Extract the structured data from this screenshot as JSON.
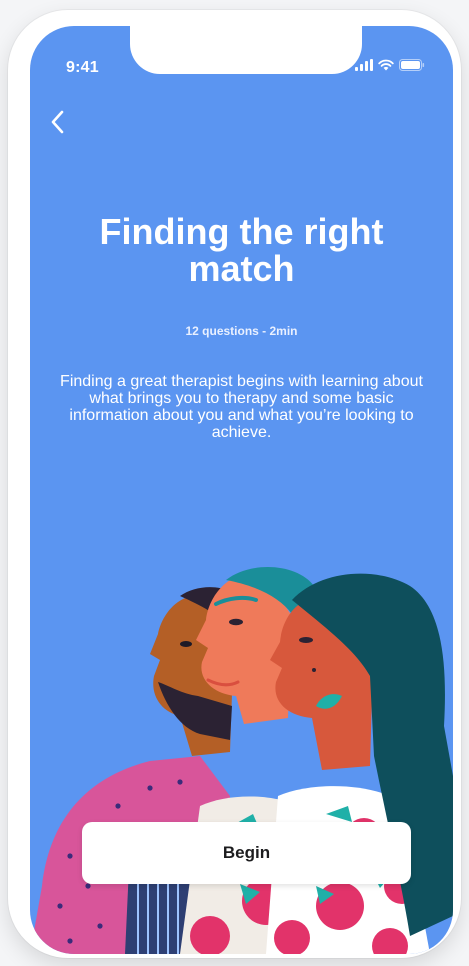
{
  "status_bar": {
    "time": "9:41",
    "icons": [
      "signal-icon",
      "wifi-icon",
      "battery-icon"
    ]
  },
  "nav": {
    "back_icon": "chevron-left-icon"
  },
  "onboarding": {
    "title": "Finding the right match",
    "subtitle": "12 questions - 2min",
    "description": "Finding a great therapist begins with learning about what brings you to therapy and some basic information about you and what you’re looking to achieve.",
    "begin_label": "Begin"
  },
  "colors": {
    "background": "#5b95f1",
    "button_bg": "#ffffff",
    "button_text": "#1d1d1f"
  }
}
